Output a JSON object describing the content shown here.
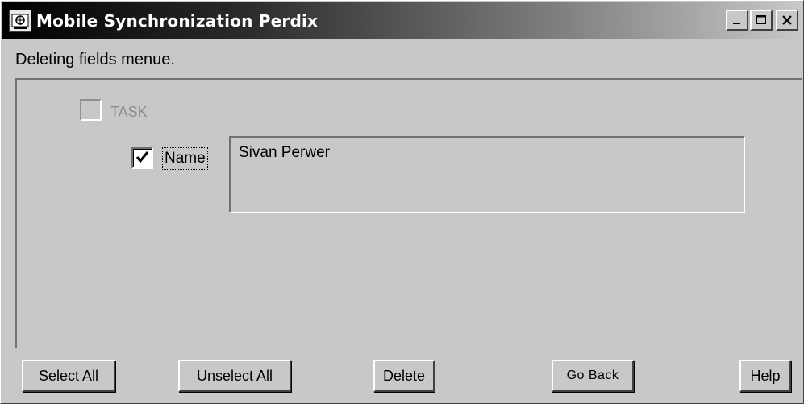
{
  "window": {
    "title": "Mobile Synchronization Perdix",
    "icon": "app-icon",
    "controls": [
      "minimize-icon",
      "maximize-icon",
      "close-icon"
    ]
  },
  "caption": "Deleting fields menue.",
  "fields": {
    "task": {
      "label": "TASK",
      "checked": false,
      "enabled": false
    },
    "name": {
      "label": "Name",
      "checked": true,
      "value": "Sivan Perwer"
    }
  },
  "buttons": {
    "select_all": "Select All",
    "unselect_all": "Unselect All",
    "delete": "Delete",
    "go_back": "Go Back",
    "help": "Help"
  },
  "colors": {
    "background": "#c8c8c8",
    "title_gradient_start": "#000000",
    "title_gradient_end": "#c8c8c8",
    "disabled_text": "#8c8c8c"
  }
}
